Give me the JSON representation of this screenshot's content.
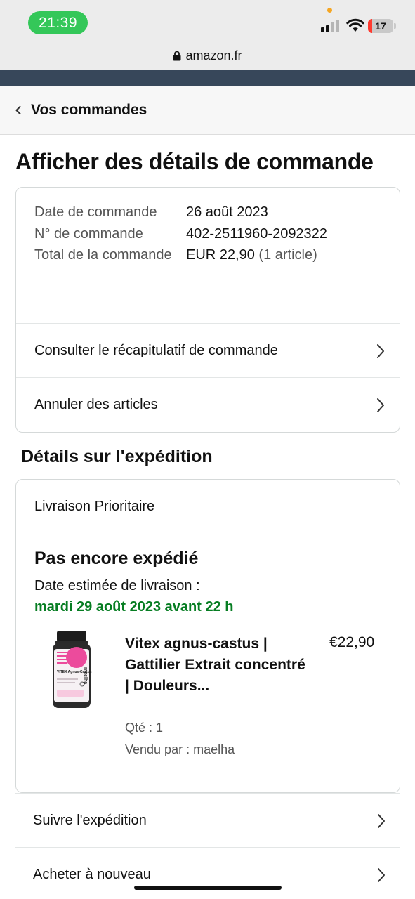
{
  "status_bar": {
    "time": "21:39",
    "battery_level": "17",
    "battery_fraction": 0.17,
    "signal_bars_active": 2,
    "signal_bars_total": 4,
    "colors": {
      "time_pill": "#34c759",
      "battery_low": "#ff3b30",
      "mic_dot": "#f5a623"
    }
  },
  "browser": {
    "url": "amazon.fr",
    "lock_icon": "lock-icon"
  },
  "header": {
    "back_label": "Vos commandes",
    "back_icon": "chevron-left-icon"
  },
  "page": {
    "title": "Afficher des détails de commande"
  },
  "order": {
    "date_label": "Date de commande",
    "date_value": "26 août 2023",
    "number_label": "N° de commande",
    "number_value": "402-2511960-2092322",
    "total_label": "Total de la commande",
    "total_value": "EUR 22,90",
    "total_items": "(1 article)",
    "links": [
      {
        "label": "Consulter le récapitulatif de commande"
      },
      {
        "label": "Annuler des articles"
      }
    ]
  },
  "shipment": {
    "section_title": "Détails sur l'expédition",
    "delivery_type": "Livraison Prioritaire",
    "status": "Pas encore expédié",
    "estimated_label": "Date estimée de livraison :",
    "estimated_date": "mardi 29 août 2023 avant 22 h",
    "colors": {
      "estimated_date": "#067d22"
    },
    "item": {
      "title": "Vitex agnus-castus | Gattilier Extrait concentré | Douleurs...",
      "price": "€22,90",
      "quantity": "Qté : 1",
      "seller": "Vendu par : maelha",
      "image_label": "maelha",
      "image_sub": "VITEX Agnus-Castus"
    }
  },
  "actions": [
    {
      "label": "Suivre l'expédition"
    },
    {
      "label": "Acheter à nouveau"
    }
  ]
}
